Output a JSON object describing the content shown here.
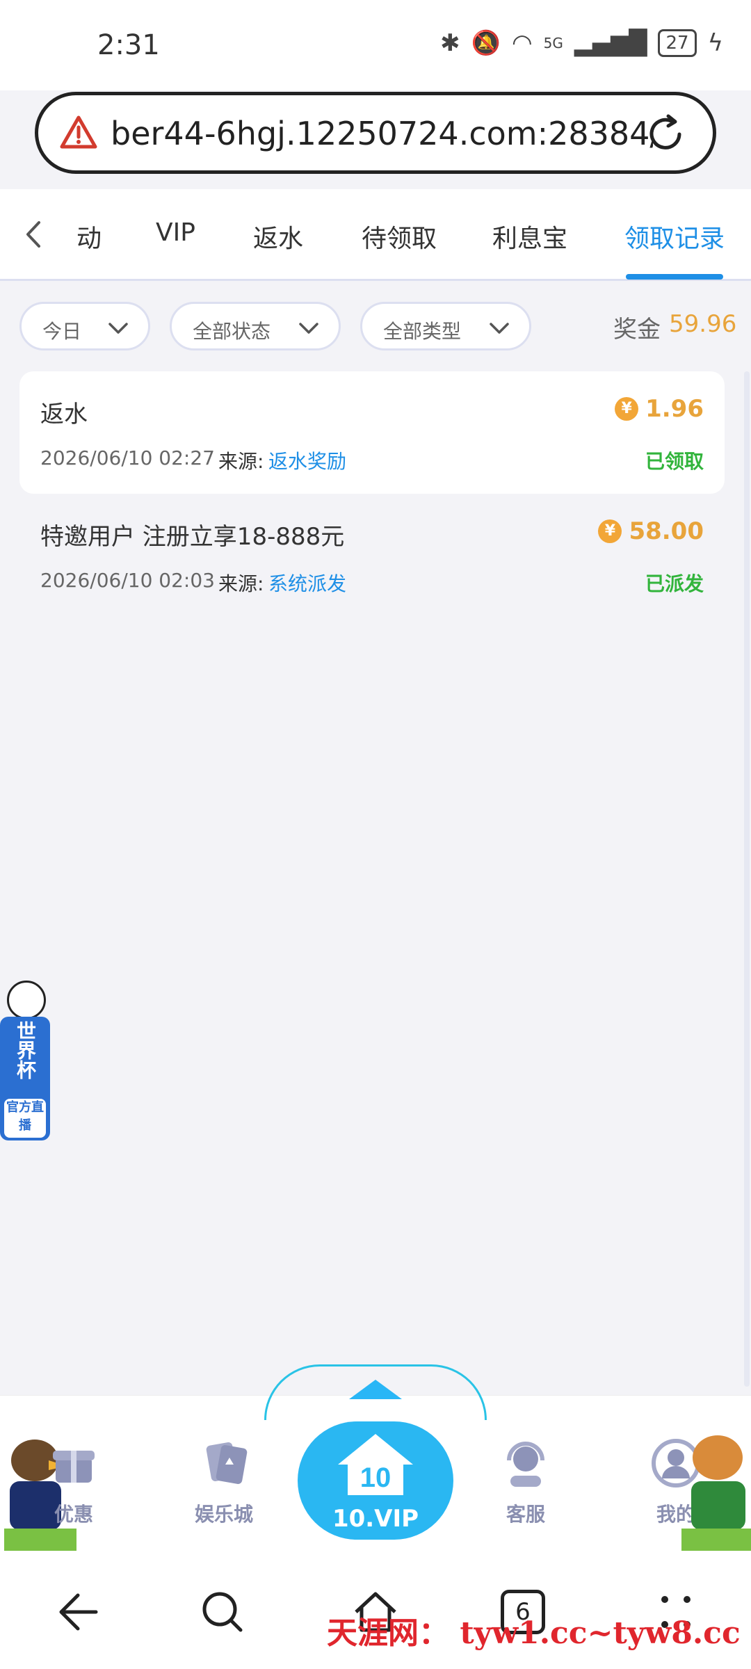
{
  "status_bar": {
    "time": "2:31",
    "network": "5G",
    "battery": "27"
  },
  "browser": {
    "url": "ber44-6hgj.12250724.com:28384/"
  },
  "tabs": [
    {
      "label": "动",
      "active": false
    },
    {
      "label": "VIP",
      "active": false
    },
    {
      "label": "返水",
      "active": false
    },
    {
      "label": "待领取",
      "active": false
    },
    {
      "label": "利息宝",
      "active": false
    },
    {
      "label": "领取记录",
      "active": true
    }
  ],
  "filters": {
    "date": "今日",
    "status": "全部状态",
    "type": "全部类型",
    "bonus_label": "奖金",
    "bonus_value": "59.96"
  },
  "records": [
    {
      "title": "返水",
      "amount": "1.96",
      "date": "2026/06/10 02:27",
      "source_label": "来源:",
      "source": "返水奖励",
      "status": "已领取"
    },
    {
      "title": "特邀用户 注册立享18-888元",
      "amount": "58.00",
      "date": "2026/06/10 02:03",
      "source_label": "来源:",
      "source": "系统派发",
      "status": "已派发"
    }
  ],
  "world_cup": {
    "title": "世界杯",
    "subtitle": "官方直播"
  },
  "bottom_nav": {
    "discount": "优惠",
    "casino": "娱乐城",
    "vip_level": "10",
    "vip": "10.VIP",
    "service": "客服",
    "mine": "我的"
  },
  "system_nav": {
    "tabs_count": "6"
  },
  "watermark": "天涯网： tyw1.cc~tyw8.cc",
  "colors": {
    "accent": "#1e8fe6",
    "gold": "#e8a43b",
    "success": "#32b43c",
    "vip": "#2ab7f2"
  }
}
